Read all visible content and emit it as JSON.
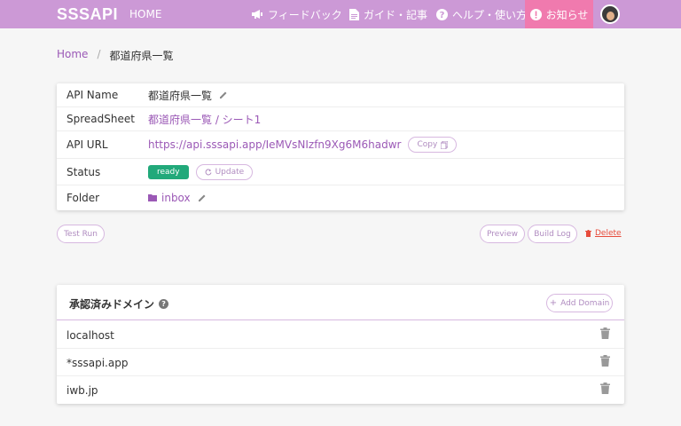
{
  "header": {
    "logo": "SSSAPI",
    "home": "HOME",
    "nav": {
      "feedback": "フィードバック",
      "guide": "ガイド・記事",
      "help": "ヘルプ・使い方",
      "notify": "お知らせ"
    },
    "bg_color": "#cc99d6",
    "notify_color": "#f07aae"
  },
  "breadcrumb": {
    "home": "Home",
    "separator": "/",
    "current": "都道府県一覧"
  },
  "info": {
    "rows": [
      {
        "label": "API Name",
        "value": "都道府県一覧"
      },
      {
        "label": "SpreadSheet",
        "value": "都道府県一覧 / シート1"
      },
      {
        "label": "API URL",
        "value": "https://api.sssapi.app/IeMVsNIzfn9Xg6M6hadwr",
        "copy_label": "Copy"
      },
      {
        "label": "Status",
        "value": "ready",
        "update_label": "Update"
      },
      {
        "label": "Folder",
        "value": "inbox"
      }
    ]
  },
  "actions": {
    "test_run": "Test Run",
    "preview": "Preview",
    "build_log": "Build Log",
    "delete": "Delete"
  },
  "domains": {
    "title": "承認済みドメイン",
    "add_label": "Add Domain",
    "items": [
      "localhost",
      "*sssapi.app",
      "iwb.jp"
    ]
  },
  "colors": {
    "accent": "#9b59b6",
    "ready": "#21a97a",
    "delete": "#e74c3c"
  }
}
